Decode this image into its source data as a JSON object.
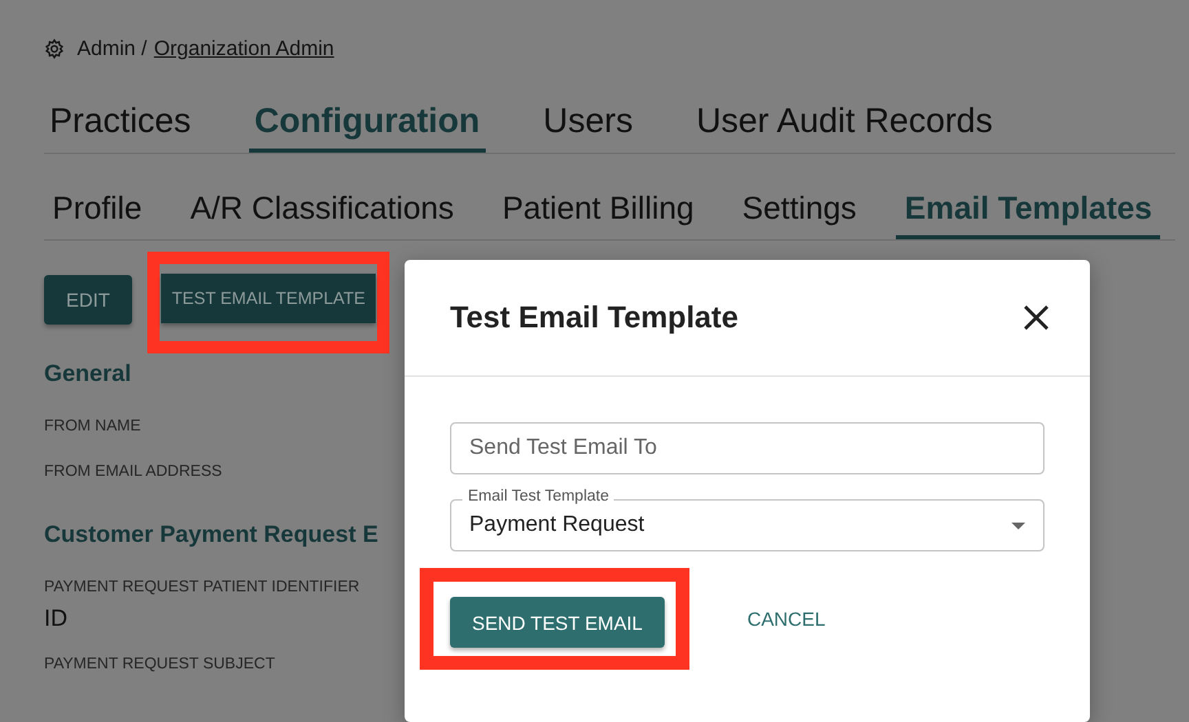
{
  "breadcrumb": {
    "path": "Admin /",
    "link": "Organization Admin"
  },
  "main_tabs": [
    {
      "label": "Practices",
      "selected": false
    },
    {
      "label": "Configuration",
      "selected": true
    },
    {
      "label": "Users",
      "selected": false
    },
    {
      "label": "User Audit Records",
      "selected": false
    }
  ],
  "sub_tabs": [
    {
      "label": "Profile",
      "selected": false
    },
    {
      "label": "A/R Classifications",
      "selected": false
    },
    {
      "label": "Patient Billing",
      "selected": false
    },
    {
      "label": "Settings",
      "selected": false
    },
    {
      "label": "Email Templates",
      "selected": true
    }
  ],
  "actions": [
    {
      "label": "EDIT",
      "highlighted": false
    },
    {
      "label": "TEST EMAIL TEMPLATE",
      "highlighted": true
    }
  ],
  "sections": [
    {
      "title": "General",
      "fields": [
        {
          "label": "FROM NAME"
        },
        {
          "label": "FROM EMAIL ADDRESS"
        }
      ]
    },
    {
      "title": "Customer Payment Request E",
      "fields": [
        {
          "label": "PAYMENT REQUEST PATIENT IDENTIFIER",
          "value": "ID"
        },
        {
          "label": "PAYMENT REQUEST SUBJECT"
        }
      ]
    }
  ],
  "dialog": {
    "title": "Test Email Template",
    "email_field": {
      "placeholder": "Send Test Email To"
    },
    "template_select": {
      "label": "Email Test Template",
      "value": "Payment Request"
    },
    "buttons": [
      {
        "label": "SEND TEST EMAIL",
        "kind": "primary",
        "highlighted": true
      },
      {
        "label": "CANCEL",
        "kind": "text",
        "highlighted": false
      }
    ]
  }
}
